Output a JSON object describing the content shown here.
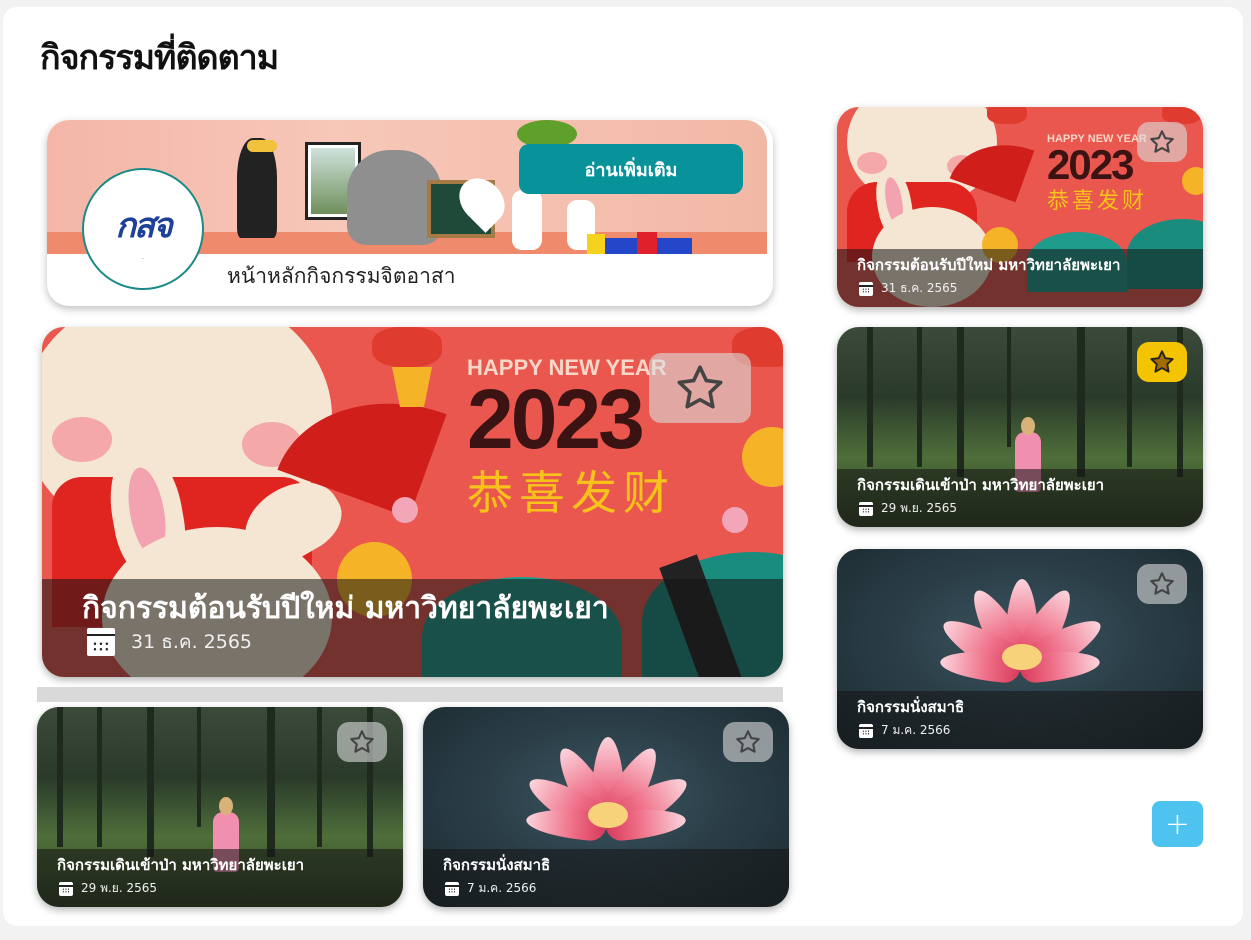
{
  "page": {
    "title": "กิจกรรมที่ติดตาม"
  },
  "hero": {
    "read_more_label": "อ่านเพิ่มเติม",
    "home_label": "หน้าหลักกิจกรรมจิตอาสา",
    "logo_text": "กสจ"
  },
  "featured": {
    "title": "กิจกรรมต้อนรับปีใหม่ มหาวิทยาลัยพะเยา",
    "date": "31 ธ.ค. 2565",
    "starred": false,
    "image": {
      "hny": "HAPPY NEW YEAR",
      "year": "2023",
      "chinese": "恭喜发财"
    }
  },
  "bottom_cards": [
    {
      "title": "กิจกรรมเดินเข้าป่า มหาวิทยาลัยพะเยา",
      "date": "29 พ.ย. 2565",
      "starred": false
    },
    {
      "title": "กิจกรรมนั่งสมาธิ",
      "date": "7 ม.ค. 2566",
      "starred": false
    }
  ],
  "side_cards": [
    {
      "title": "กิจกรรมต้อนรับปีใหม่ มหาวิทยาลัยพะเยา",
      "date": "31 ธ.ค. 2565",
      "starred": false,
      "image": {
        "hny": "HAPPY NEW YEAR",
        "year": "2023",
        "chinese": "恭喜发财"
      }
    },
    {
      "title": "กิจกรรมเดินเข้าป่า มหาวิทยาลัยพะเยา",
      "date": "29 พ.ย. 2565",
      "starred": true
    },
    {
      "title": "กิจกรรมนั่งสมาธิ",
      "date": "7 ม.ค. 2566",
      "starred": false
    }
  ],
  "fab": {
    "label": "+"
  },
  "icons": {
    "star": "star-icon",
    "calendar": "calendar-icon",
    "add": "plus-icon"
  },
  "colors": {
    "accent_teal": "#08939a",
    "star_active": "#f5c400",
    "fab": "#4fc3f0"
  }
}
